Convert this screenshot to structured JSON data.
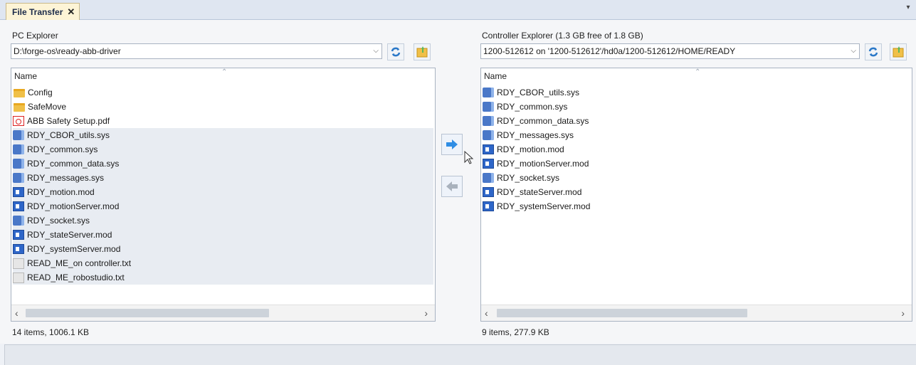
{
  "tab": {
    "label": "File Transfer",
    "close": "✕"
  },
  "left": {
    "title": "PC Explorer",
    "path": "D:\\forge-os\\ready-abb-driver",
    "header": "Name",
    "files": [
      {
        "name": "Config",
        "type": "folder"
      },
      {
        "name": "SafeMove",
        "type": "folder"
      },
      {
        "name": "ABB Safety Setup.pdf",
        "type": "pdf"
      },
      {
        "name": "RDY_CBOR_utils.sys",
        "type": "sys"
      },
      {
        "name": "RDY_common.sys",
        "type": "sys"
      },
      {
        "name": "RDY_common_data.sys",
        "type": "sys"
      },
      {
        "name": "RDY_messages.sys",
        "type": "sys"
      },
      {
        "name": "RDY_motion.mod",
        "type": "mod"
      },
      {
        "name": "RDY_motionServer.mod",
        "type": "mod"
      },
      {
        "name": "RDY_socket.sys",
        "type": "sys"
      },
      {
        "name": "RDY_stateServer.mod",
        "type": "mod"
      },
      {
        "name": "RDY_systemServer.mod",
        "type": "mod"
      },
      {
        "name": "READ_ME_on controller.txt",
        "type": "txt"
      },
      {
        "name": "READ_ME_robostudio.txt",
        "type": "txt"
      }
    ],
    "status": "14 items, 1006.1 KB"
  },
  "right": {
    "title": "Controller Explorer (1.3 GB free of 1.8 GB)",
    "path": "1200-512612 on '1200-512612'/hd0a/1200-512612/HOME/READY",
    "header": "Name",
    "files": [
      {
        "name": "RDY_CBOR_utils.sys",
        "type": "sys"
      },
      {
        "name": "RDY_common.sys",
        "type": "sys"
      },
      {
        "name": "RDY_common_data.sys",
        "type": "sys"
      },
      {
        "name": "RDY_messages.sys",
        "type": "sys"
      },
      {
        "name": "RDY_motion.mod",
        "type": "mod"
      },
      {
        "name": "RDY_motionServer.mod",
        "type": "mod"
      },
      {
        "name": "RDY_socket.sys",
        "type": "sys"
      },
      {
        "name": "RDY_stateServer.mod",
        "type": "mod"
      },
      {
        "name": "RDY_systemServer.mod",
        "type": "mod"
      }
    ],
    "status": "9 items, 277.9 KB"
  },
  "icons": {
    "refresh": "refresh-icon",
    "new_folder": "new-folder-icon",
    "transfer_right": "arrow-right-icon",
    "transfer_left": "arrow-left-icon"
  }
}
